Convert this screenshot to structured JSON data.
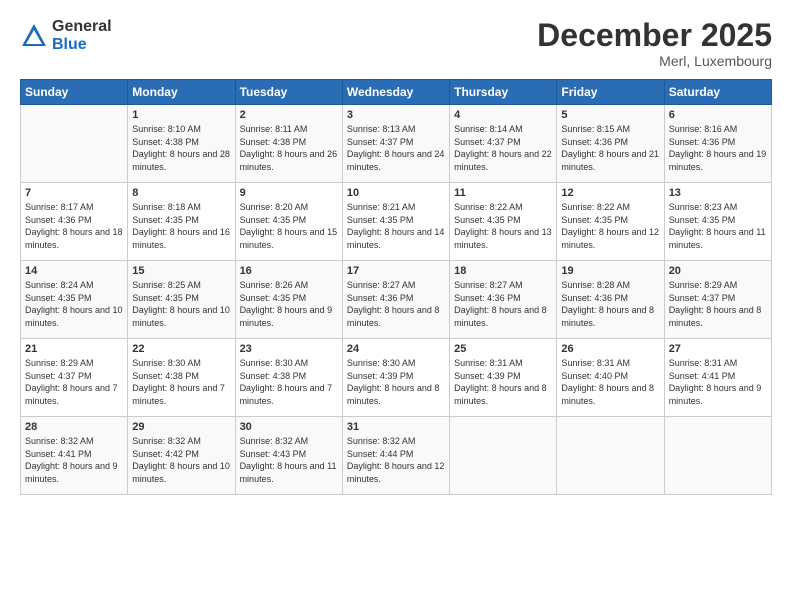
{
  "logo": {
    "general": "General",
    "blue": "Blue"
  },
  "title": "December 2025",
  "subtitle": "Merl, Luxembourg",
  "header": {
    "days": [
      "Sunday",
      "Monday",
      "Tuesday",
      "Wednesday",
      "Thursday",
      "Friday",
      "Saturday"
    ]
  },
  "weeks": [
    [
      {
        "day": "",
        "sunrise": "",
        "sunset": "",
        "daylight": ""
      },
      {
        "day": "1",
        "sunrise": "Sunrise: 8:10 AM",
        "sunset": "Sunset: 4:38 PM",
        "daylight": "Daylight: 8 hours and 28 minutes."
      },
      {
        "day": "2",
        "sunrise": "Sunrise: 8:11 AM",
        "sunset": "Sunset: 4:38 PM",
        "daylight": "Daylight: 8 hours and 26 minutes."
      },
      {
        "day": "3",
        "sunrise": "Sunrise: 8:13 AM",
        "sunset": "Sunset: 4:37 PM",
        "daylight": "Daylight: 8 hours and 24 minutes."
      },
      {
        "day": "4",
        "sunrise": "Sunrise: 8:14 AM",
        "sunset": "Sunset: 4:37 PM",
        "daylight": "Daylight: 8 hours and 22 minutes."
      },
      {
        "day": "5",
        "sunrise": "Sunrise: 8:15 AM",
        "sunset": "Sunset: 4:36 PM",
        "daylight": "Daylight: 8 hours and 21 minutes."
      },
      {
        "day": "6",
        "sunrise": "Sunrise: 8:16 AM",
        "sunset": "Sunset: 4:36 PM",
        "daylight": "Daylight: 8 hours and 19 minutes."
      }
    ],
    [
      {
        "day": "7",
        "sunrise": "Sunrise: 8:17 AM",
        "sunset": "Sunset: 4:36 PM",
        "daylight": "Daylight: 8 hours and 18 minutes."
      },
      {
        "day": "8",
        "sunrise": "Sunrise: 8:18 AM",
        "sunset": "Sunset: 4:35 PM",
        "daylight": "Daylight: 8 hours and 16 minutes."
      },
      {
        "day": "9",
        "sunrise": "Sunrise: 8:20 AM",
        "sunset": "Sunset: 4:35 PM",
        "daylight": "Daylight: 8 hours and 15 minutes."
      },
      {
        "day": "10",
        "sunrise": "Sunrise: 8:21 AM",
        "sunset": "Sunset: 4:35 PM",
        "daylight": "Daylight: 8 hours and 14 minutes."
      },
      {
        "day": "11",
        "sunrise": "Sunrise: 8:22 AM",
        "sunset": "Sunset: 4:35 PM",
        "daylight": "Daylight: 8 hours and 13 minutes."
      },
      {
        "day": "12",
        "sunrise": "Sunrise: 8:22 AM",
        "sunset": "Sunset: 4:35 PM",
        "daylight": "Daylight: 8 hours and 12 minutes."
      },
      {
        "day": "13",
        "sunrise": "Sunrise: 8:23 AM",
        "sunset": "Sunset: 4:35 PM",
        "daylight": "Daylight: 8 hours and 11 minutes."
      }
    ],
    [
      {
        "day": "14",
        "sunrise": "Sunrise: 8:24 AM",
        "sunset": "Sunset: 4:35 PM",
        "daylight": "Daylight: 8 hours and 10 minutes."
      },
      {
        "day": "15",
        "sunrise": "Sunrise: 8:25 AM",
        "sunset": "Sunset: 4:35 PM",
        "daylight": "Daylight: 8 hours and 10 minutes."
      },
      {
        "day": "16",
        "sunrise": "Sunrise: 8:26 AM",
        "sunset": "Sunset: 4:35 PM",
        "daylight": "Daylight: 8 hours and 9 minutes."
      },
      {
        "day": "17",
        "sunrise": "Sunrise: 8:27 AM",
        "sunset": "Sunset: 4:36 PM",
        "daylight": "Daylight: 8 hours and 8 minutes."
      },
      {
        "day": "18",
        "sunrise": "Sunrise: 8:27 AM",
        "sunset": "Sunset: 4:36 PM",
        "daylight": "Daylight: 8 hours and 8 minutes."
      },
      {
        "day": "19",
        "sunrise": "Sunrise: 8:28 AM",
        "sunset": "Sunset: 4:36 PM",
        "daylight": "Daylight: 8 hours and 8 minutes."
      },
      {
        "day": "20",
        "sunrise": "Sunrise: 8:29 AM",
        "sunset": "Sunset: 4:37 PM",
        "daylight": "Daylight: 8 hours and 8 minutes."
      }
    ],
    [
      {
        "day": "21",
        "sunrise": "Sunrise: 8:29 AM",
        "sunset": "Sunset: 4:37 PM",
        "daylight": "Daylight: 8 hours and 7 minutes."
      },
      {
        "day": "22",
        "sunrise": "Sunrise: 8:30 AM",
        "sunset": "Sunset: 4:38 PM",
        "daylight": "Daylight: 8 hours and 7 minutes."
      },
      {
        "day": "23",
        "sunrise": "Sunrise: 8:30 AM",
        "sunset": "Sunset: 4:38 PM",
        "daylight": "Daylight: 8 hours and 7 minutes."
      },
      {
        "day": "24",
        "sunrise": "Sunrise: 8:30 AM",
        "sunset": "Sunset: 4:39 PM",
        "daylight": "Daylight: 8 hours and 8 minutes."
      },
      {
        "day": "25",
        "sunrise": "Sunrise: 8:31 AM",
        "sunset": "Sunset: 4:39 PM",
        "daylight": "Daylight: 8 hours and 8 minutes."
      },
      {
        "day": "26",
        "sunrise": "Sunrise: 8:31 AM",
        "sunset": "Sunset: 4:40 PM",
        "daylight": "Daylight: 8 hours and 8 minutes."
      },
      {
        "day": "27",
        "sunrise": "Sunrise: 8:31 AM",
        "sunset": "Sunset: 4:41 PM",
        "daylight": "Daylight: 8 hours and 9 minutes."
      }
    ],
    [
      {
        "day": "28",
        "sunrise": "Sunrise: 8:32 AM",
        "sunset": "Sunset: 4:41 PM",
        "daylight": "Daylight: 8 hours and 9 minutes."
      },
      {
        "day": "29",
        "sunrise": "Sunrise: 8:32 AM",
        "sunset": "Sunset: 4:42 PM",
        "daylight": "Daylight: 8 hours and 10 minutes."
      },
      {
        "day": "30",
        "sunrise": "Sunrise: 8:32 AM",
        "sunset": "Sunset: 4:43 PM",
        "daylight": "Daylight: 8 hours and 11 minutes."
      },
      {
        "day": "31",
        "sunrise": "Sunrise: 8:32 AM",
        "sunset": "Sunset: 4:44 PM",
        "daylight": "Daylight: 8 hours and 12 minutes."
      },
      {
        "day": "",
        "sunrise": "",
        "sunset": "",
        "daylight": ""
      },
      {
        "day": "",
        "sunrise": "",
        "sunset": "",
        "daylight": ""
      },
      {
        "day": "",
        "sunrise": "",
        "sunset": "",
        "daylight": ""
      }
    ]
  ]
}
